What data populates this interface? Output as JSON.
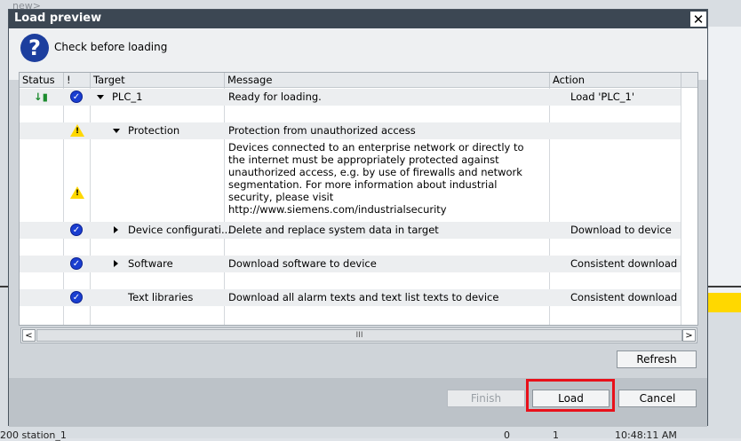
{
  "dialog": {
    "title": "Load preview",
    "header_text": "Check before loading",
    "columns": [
      "Status",
      "!",
      "Target",
      "Message",
      "Action"
    ],
    "rows": [
      {
        "target": "PLC_1",
        "message": "Ready for loading.",
        "action": "Load 'PLC_1'"
      },
      {
        "target": "Protection",
        "message": "Protection from unauthorized access",
        "action": ""
      },
      {
        "target": "",
        "message": "Devices connected to an enterprise network or directly to the internet must be appropriately protected against unauthorized access, e.g. by use of firewalls and network segmentation. For more information about industrial security, please visit http://www.siemens.com/industrialsecurity",
        "action": ""
      },
      {
        "target": "Device configurati...",
        "message": "Delete and replace system data in target",
        "action": "Download to device"
      },
      {
        "target": "Software",
        "message": "Download software to device",
        "action": "Consistent download"
      },
      {
        "target": "Text libraries",
        "message": "Download all alarm texts and text list texts to device",
        "action": "Consistent download"
      }
    ],
    "scroll_thumb": "III",
    "buttons": {
      "refresh": "Refresh",
      "finish": "Finish",
      "load": "Load",
      "cancel": "Cancel"
    }
  },
  "background": {
    "top_text": "new>",
    "status_line": [
      "200 station_1",
      "0",
      "1",
      "10:48:11 AM"
    ]
  }
}
